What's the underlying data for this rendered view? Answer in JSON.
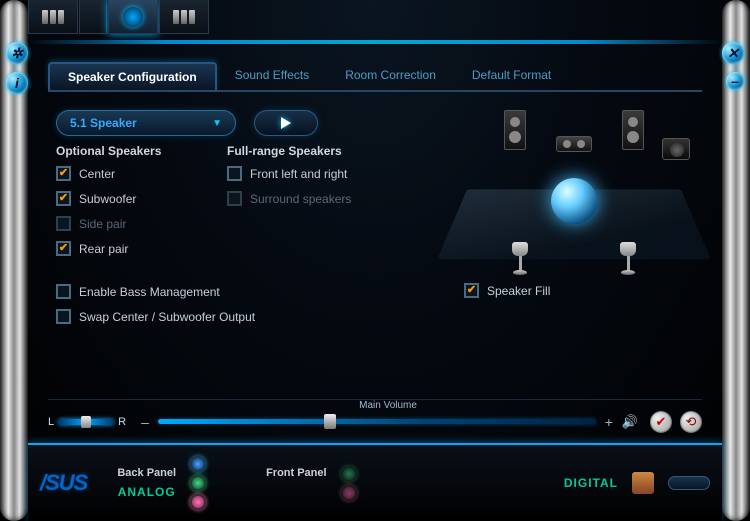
{
  "tabs": [
    "Speaker Configuration",
    "Sound Effects",
    "Room Correction",
    "Default Format"
  ],
  "activeTab": 0,
  "dropdown": "5.1 Speaker",
  "headers": {
    "optional": "Optional Speakers",
    "fullrange": "Full-range Speakers"
  },
  "optional": [
    {
      "label": "Center",
      "checked": true,
      "dim": false
    },
    {
      "label": "Subwoofer",
      "checked": true,
      "dim": false
    },
    {
      "label": "Side pair",
      "checked": false,
      "dim": true
    },
    {
      "label": "Rear pair",
      "checked": true,
      "dim": false
    }
  ],
  "fullrange": [
    {
      "label": "Front left and right",
      "checked": false,
      "dim": false
    },
    {
      "label": "Surround speakers",
      "checked": false,
      "dim": true
    }
  ],
  "extra": [
    {
      "label": "Enable Bass Management",
      "checked": false
    },
    {
      "label": "Swap Center / Subwoofer Output",
      "checked": false
    }
  ],
  "speakerFill": {
    "label": "Speaker Fill",
    "checked": true
  },
  "volume": {
    "mainLabel": "Main Volume",
    "L": "L",
    "R": "R",
    "minus": "–",
    "plus": "+"
  },
  "bottom": {
    "logo": "/SUS",
    "back": "Back Panel",
    "front": "Front Panel",
    "analog": "ANALOG",
    "digital": "DIGITAL"
  }
}
